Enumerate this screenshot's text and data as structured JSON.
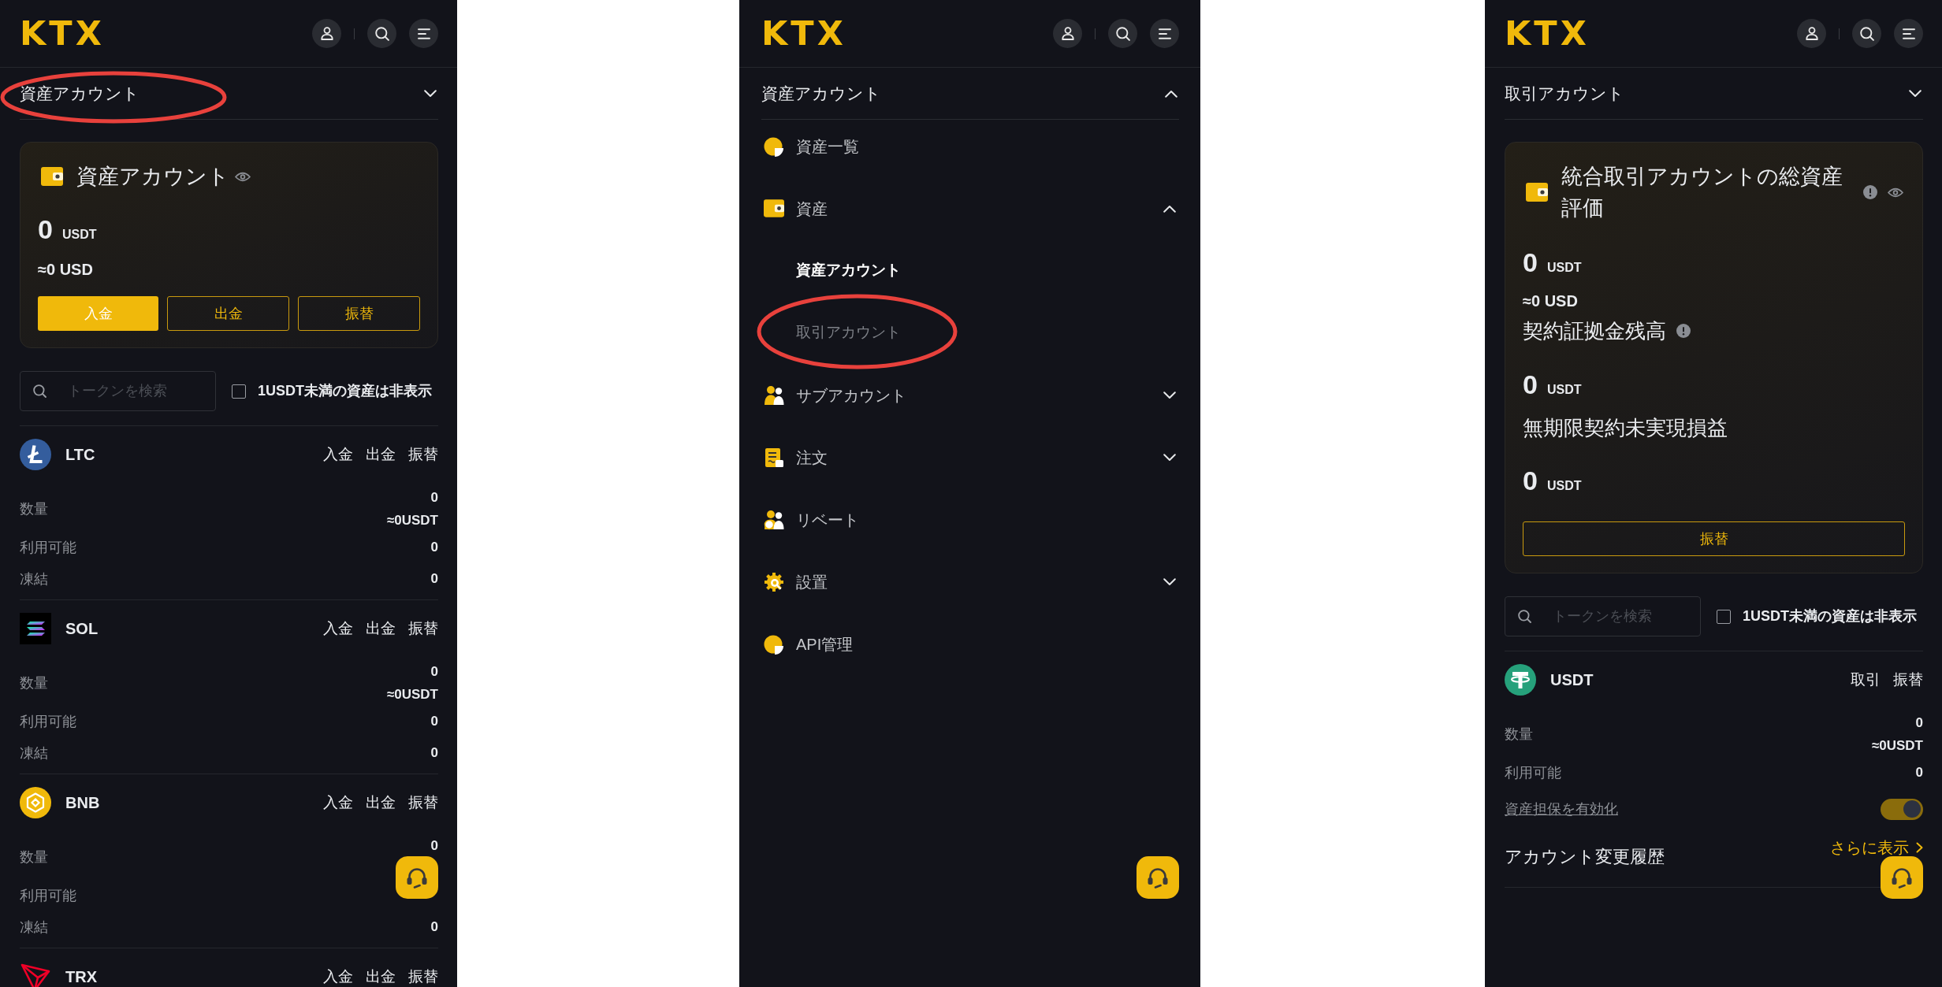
{
  "panels": [
    {
      "kind": "account",
      "logo": "KTX",
      "account_selector": {
        "label": "資産アカウント",
        "expanded": false,
        "annotated": true
      },
      "card": {
        "title": "資産アカウント",
        "info_icon": false,
        "amount": "0",
        "unit": "USDT",
        "usd_value": "≈0 USD",
        "buttons": [
          {
            "label": "入金",
            "kind": "primary"
          },
          {
            "label": "出金",
            "kind": "outline"
          },
          {
            "label": "振替",
            "kind": "outline"
          }
        ]
      },
      "search": {
        "placeholder": "トークンを検索"
      },
      "hide_small_assets": {
        "label": "1USDT未満の資産は非表示",
        "checked": false
      },
      "assets": [
        {
          "symbol": "LTC",
          "actions": [
            "入金",
            "出金",
            "振替"
          ],
          "rows": [
            {
              "kind": "quantity",
              "label": "数量",
              "value": "0",
              "sub_value": "≈0USDT"
            },
            {
              "kind": "value",
              "label": "利用可能",
              "value": "0"
            },
            {
              "kind": "value",
              "label": "凍結",
              "value": "0"
            }
          ]
        },
        {
          "symbol": "SOL",
          "actions": [
            "入金",
            "出金",
            "振替"
          ],
          "rows": [
            {
              "kind": "quantity",
              "label": "数量",
              "value": "0",
              "sub_value": "≈0USDT"
            },
            {
              "kind": "value",
              "label": "利用可能",
              "value": "0"
            },
            {
              "kind": "value",
              "label": "凍結",
              "value": "0"
            }
          ]
        },
        {
          "symbol": "BNB",
          "actions": [
            "入金",
            "出金",
            "振替"
          ],
          "rows": [
            {
              "kind": "quantity",
              "label": "数量",
              "value": "0"
            },
            {
              "kind": "value",
              "label": "利用可能"
            },
            {
              "kind": "value",
              "label": "凍結",
              "value": "0"
            }
          ]
        },
        {
          "symbol": "TRX",
          "actions": [
            "入金",
            "出金",
            "振替"
          ]
        }
      ]
    },
    {
      "kind": "menu",
      "logo": "KTX",
      "account_selector": {
        "label": "資産アカウント",
        "expanded": true,
        "annotated": false
      },
      "menu": [
        {
          "kind": "link",
          "label": "資産一覧"
        },
        {
          "kind": "group",
          "label": "資産",
          "expanded": true,
          "children": [
            {
              "label": "資産アカウント",
              "selected": true,
              "annotated": false
            },
            {
              "label": "取引アカウント",
              "selected": false,
              "annotated": true
            }
          ]
        },
        {
          "kind": "group",
          "label": "サブアカウント",
          "expanded": false
        },
        {
          "kind": "group",
          "label": "注文",
          "expanded": false
        },
        {
          "kind": "link",
          "label": "リベート"
        },
        {
          "kind": "group",
          "label": "設置",
          "expanded": false
        },
        {
          "kind": "link",
          "label": "API管理"
        }
      ]
    },
    {
      "kind": "account",
      "logo": "KTX",
      "account_selector": {
        "label": "取引アカウント",
        "expanded": false,
        "annotated": false
      },
      "card": {
        "title": "統合取引アカウントの総資産評価",
        "info_icon": true,
        "amount": "0",
        "unit": "USDT",
        "usd_value": "≈0 USD",
        "sections": [
          {
            "label": "契約証拠金残高",
            "info_icon": true,
            "amount": "0",
            "unit": "USDT"
          },
          {
            "label": "無期限契約未実現損益",
            "info_icon": false,
            "amount": "0",
            "unit": "USDT"
          }
        ],
        "buttons": [
          {
            "label": "振替",
            "kind": "outline"
          }
        ]
      },
      "search": {
        "placeholder": "トークンを検索"
      },
      "hide_small_assets": {
        "label": "1USDT未満の資産は非表示",
        "checked": false
      },
      "assets": [
        {
          "symbol": "USDT",
          "actions": [
            "取引",
            "振替"
          ],
          "rows": [
            {
              "kind": "quantity",
              "label": "数量",
              "value": "0",
              "sub_value": "≈0USDT"
            },
            {
              "kind": "value",
              "label": "利用可能",
              "value": "0"
            },
            {
              "kind": "toggle",
              "label": "資産担保を有効化",
              "on": true
            }
          ]
        }
      ],
      "history": {
        "title": "アカウント変更履歴",
        "link": "さらに表示"
      }
    }
  ]
}
